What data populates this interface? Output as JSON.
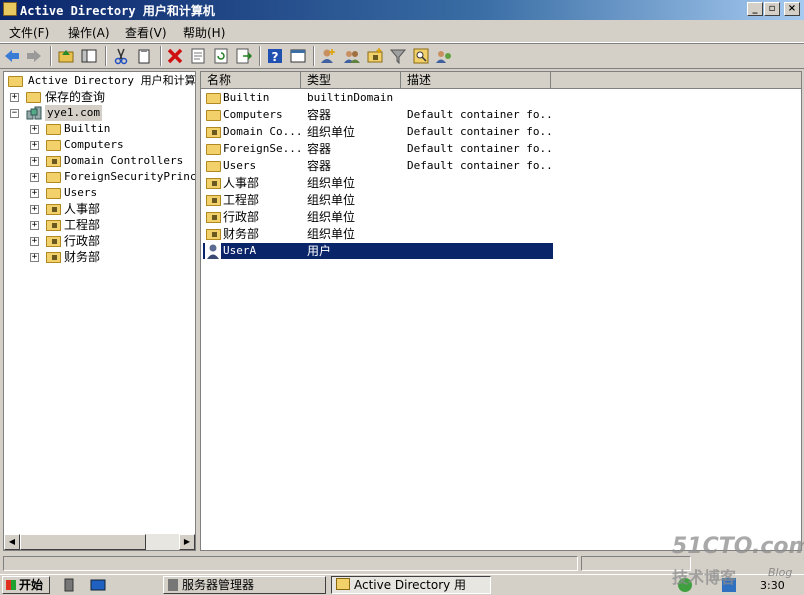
{
  "window": {
    "title": "Active Directory 用户和计算机"
  },
  "caption_buttons": {
    "minimize": "_",
    "restore": "▫",
    "close": "×"
  },
  "menu": [
    {
      "label": "文件(F)"
    },
    {
      "label": "操作(A)"
    },
    {
      "label": "查看(V)"
    },
    {
      "label": "帮助(H)"
    }
  ],
  "toolbar_icons": [
    "back-icon",
    "forward-icon",
    "up-folder-icon",
    "show-tree-icon",
    "cut-icon",
    "copy-icon",
    "delete-icon",
    "properties-icon",
    "refresh-icon",
    "export-icon",
    "help-icon",
    "view-icon",
    "new-user-icon",
    "new-group-icon",
    "new-ou-icon",
    "filter-icon",
    "find-icon",
    "add-to-group-icon"
  ],
  "tree": {
    "root": "Active Directory 用户和计算机",
    "saved_queries": "保存的查询",
    "domain": "yye1.com",
    "children": [
      "Builtin",
      "Computers",
      "Domain Controllers",
      "ForeignSecurityPrincip",
      "Users",
      "人事部",
      "工程部",
      "行政部",
      "财务部"
    ]
  },
  "list": {
    "columns": [
      "名称",
      "类型",
      "描述"
    ],
    "rows": [
      {
        "name": "Builtin",
        "type": "builtinDomain",
        "desc": "",
        "icon": "folder-icon"
      },
      {
        "name": "Computers",
        "type": "容器",
        "desc": "Default container fo...",
        "icon": "folder-icon"
      },
      {
        "name": "Domain Co...",
        "type": "组织单位",
        "desc": "Default container fo...",
        "icon": "ou-icon"
      },
      {
        "name": "ForeignSe...",
        "type": "容器",
        "desc": "Default container fo...",
        "icon": "folder-icon"
      },
      {
        "name": "Users",
        "type": "容器",
        "desc": "Default container fo...",
        "icon": "folder-icon"
      },
      {
        "name": "人事部",
        "type": "组织单位",
        "desc": "",
        "icon": "ou-icon"
      },
      {
        "name": "工程部",
        "type": "组织单位",
        "desc": "",
        "icon": "ou-icon"
      },
      {
        "name": "行政部",
        "type": "组织单位",
        "desc": "",
        "icon": "ou-icon"
      },
      {
        "name": "财务部",
        "type": "组织单位",
        "desc": "",
        "icon": "ou-icon"
      },
      {
        "name": "UserA",
        "type": "用户",
        "desc": "",
        "icon": "user-icon",
        "selected": true
      }
    ]
  },
  "taskbar": {
    "start": "开始",
    "tasks": [
      "服务器管理器",
      "Active Directory 用"
    ],
    "clock": "3:30"
  },
  "watermark": {
    "site": "51CTO.com",
    "sub": "技术博客",
    "tag": "Blog"
  },
  "colors": {
    "selection": "#0a246a",
    "titlebar": "#0a246a",
    "face": "#d4d0c8"
  }
}
